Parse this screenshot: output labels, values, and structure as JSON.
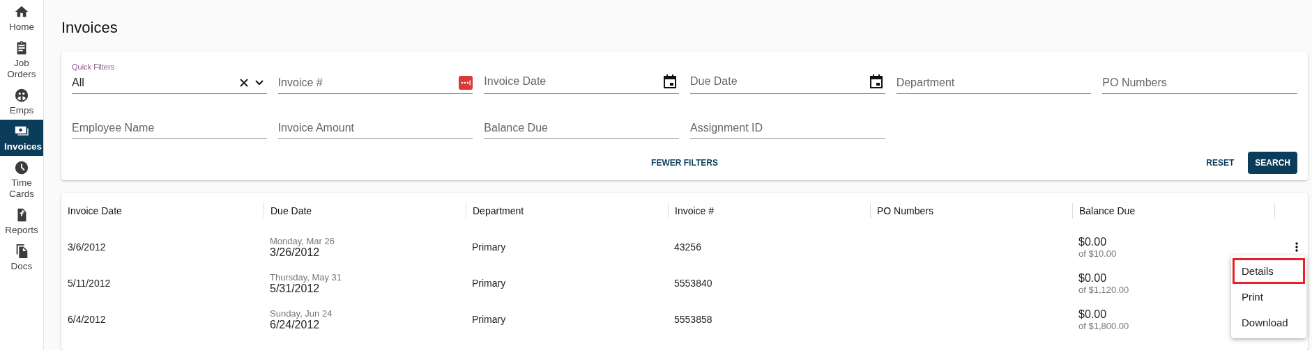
{
  "sidebar": {
    "items": [
      {
        "label": "Home",
        "selected": false
      },
      {
        "label": "Job Orders",
        "selected": false
      },
      {
        "label": "Emps",
        "selected": false
      },
      {
        "label": "Invoices",
        "selected": true
      },
      {
        "label": "Time Cards",
        "selected": false
      },
      {
        "label": "Reports",
        "selected": false
      },
      {
        "label": "Docs",
        "selected": false
      }
    ]
  },
  "page_title": "Invoices",
  "filters": {
    "fields": [
      {
        "kind": "select",
        "label": "Quick Filters",
        "value": "All"
      },
      {
        "kind": "autofill",
        "placeholder": "Invoice #"
      },
      {
        "kind": "date",
        "placeholder": "Invoice Date"
      },
      {
        "kind": "date",
        "placeholder": "Due Date"
      },
      {
        "kind": "text",
        "placeholder": "Department"
      },
      {
        "kind": "text",
        "placeholder": "PO Numbers"
      },
      {
        "kind": "text",
        "placeholder": "Employee Name"
      },
      {
        "kind": "text",
        "placeholder": "Invoice Amount"
      },
      {
        "kind": "text",
        "placeholder": "Balance Due"
      },
      {
        "kind": "text",
        "placeholder": "Assignment ID"
      }
    ],
    "toggle_button": "FEWER FILTERS",
    "reset_button": "RESET",
    "search_button": "SEARCH"
  },
  "table": {
    "columns": [
      "Invoice Date",
      "Due Date",
      "Department",
      "Invoice #",
      "PO Numbers",
      "Balance Due"
    ],
    "rows": [
      {
        "invoice_date": "3/6/2012",
        "due_weekday": "Monday, Mar 26",
        "due_date": "3/26/2012",
        "department": "Primary",
        "invoice_number": "43256",
        "po_numbers": "",
        "balance": "$0.00",
        "balance_of": "of $10.00",
        "menu_open": true
      },
      {
        "invoice_date": "5/11/2012",
        "due_weekday": "Thursday, May 31",
        "due_date": "5/31/2012",
        "department": "Primary",
        "invoice_number": "5553840",
        "po_numbers": "",
        "balance": "$0.00",
        "balance_of": "of $1,120.00",
        "menu_open": false
      },
      {
        "invoice_date": "6/4/2012",
        "due_weekday": "Sunday, Jun 24",
        "due_date": "6/24/2012",
        "department": "Primary",
        "invoice_number": "5553858",
        "po_numbers": "",
        "balance": "$0.00",
        "balance_of": "of $1,800.00",
        "menu_open": false
      }
    ]
  },
  "row_menu": {
    "items": [
      {
        "label": "Details",
        "selected": true
      },
      {
        "label": "Print",
        "selected": false
      },
      {
        "label": "Download",
        "selected": false
      }
    ]
  }
}
